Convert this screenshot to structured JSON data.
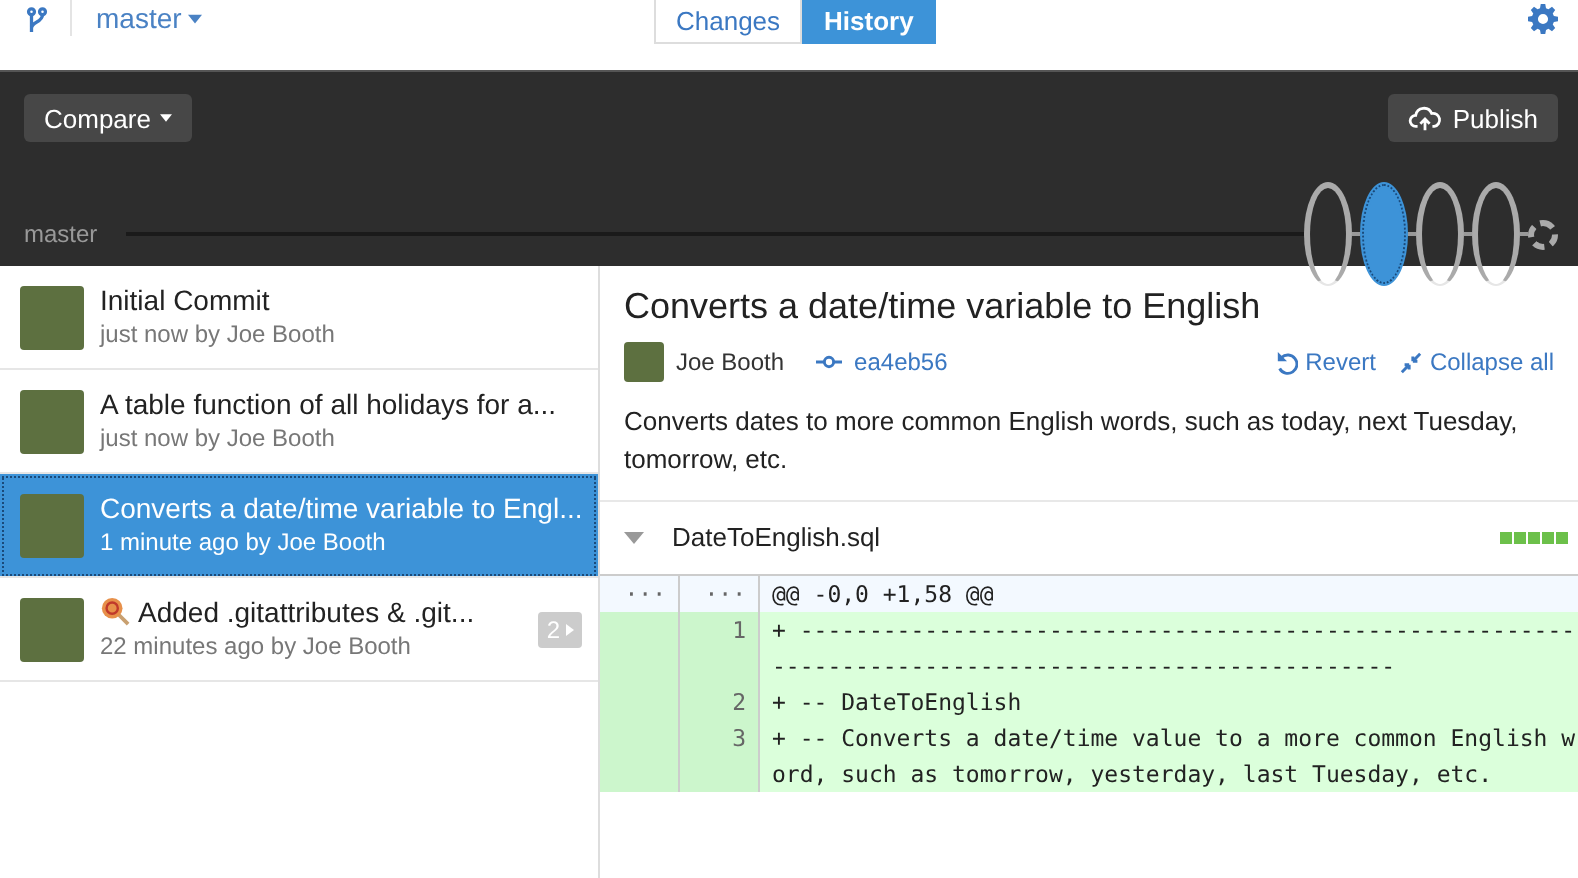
{
  "toolbar": {
    "branch": "master",
    "tabs": [
      {
        "label": "Changes",
        "selected": false
      },
      {
        "label": "History",
        "selected": true
      }
    ]
  },
  "header": {
    "compare_button": "Compare",
    "publish_button": "Publish",
    "branch_label": "master",
    "timeline": [
      {
        "kind": "commit",
        "selected": false
      },
      {
        "kind": "commit",
        "selected": true
      },
      {
        "kind": "commit",
        "selected": false
      },
      {
        "kind": "commit",
        "selected": false
      },
      {
        "kind": "pending",
        "selected": false
      }
    ]
  },
  "commits": [
    {
      "title": "Initial Commit",
      "meta": "just now by Joe Booth",
      "selected": false
    },
    {
      "title": "A table function of all holidays for a...",
      "meta": "just now by Joe Booth",
      "selected": false
    },
    {
      "title": "Converts a date/time variable to Engl...",
      "meta": "1 minute ago by Joe Booth",
      "selected": true
    },
    {
      "title": "Added .gitattributes & .git...",
      "meta": "22 minutes ago by Joe Booth",
      "selected": false,
      "emoji": true,
      "count": "2"
    }
  ],
  "detail": {
    "title": "Converts a date/time variable to English",
    "author": "Joe Booth",
    "sha": "ea4eb56",
    "revert": "Revert",
    "collapse": "Collapse all",
    "description": "Converts dates to more common English words, such as today, next Tuesday, tomorrow, etc.",
    "file": {
      "name": "DateToEnglish.sql",
      "expanded": true,
      "lines": [
        {
          "kind": "hunk",
          "old": "···",
          "new": "···",
          "text": "@@ -0,0 +1,58 @@"
        },
        {
          "kind": "added",
          "new": "1",
          "text": "+ -----------------------------------------------------------------------------------------------------"
        },
        {
          "kind": "added",
          "new": "2",
          "text": "+ -- DateToEnglish"
        },
        {
          "kind": "added",
          "new": "3",
          "text": "+ -- Converts a date/time value to a more common English word, such as tomorrow, yesterday, last Tuesday, etc."
        }
      ]
    }
  }
}
